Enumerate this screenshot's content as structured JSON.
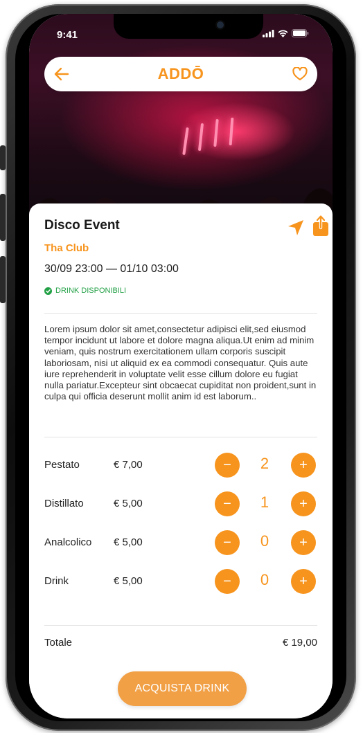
{
  "status_bar": {
    "time": "9:41"
  },
  "navbar": {
    "logo": "ADDŌ",
    "back_icon": "arrow-left-icon",
    "favorite_icon": "heart-icon"
  },
  "event": {
    "title": "Disco Event",
    "venue": "Tha Club",
    "dates": "30/09 23:00 — 01/10 03:00",
    "availability": "DRINK DISPONIBILI",
    "description": "Lorem ipsum dolor sit amet,consectetur adipisci elit,sed eiusmod tempor incidunt ut labore et dolore magna aliqua.Ut enim ad minim veniam, quis nostrum exercitationem ullam corporis suscipit laboriosam, nisi ut aliquid ex ea commodi consequatur. Quis aute iure reprehenderit in voluptate velit esse cillum dolore eu fugiat nulla pariatur.Excepteur sint obcaecat cupiditat non proident,sunt in culpa qui officia deserunt mollit anim id est laborum.."
  },
  "drinks": [
    {
      "name": "Pestato",
      "price": "€ 7,00",
      "qty": "2"
    },
    {
      "name": "Distillato",
      "price": "€ 5,00",
      "qty": "1"
    },
    {
      "name": "Analcolico",
      "price": "€ 5,00",
      "qty": "0"
    },
    {
      "name": "Drink",
      "price": "€ 5,00",
      "qty": "0"
    }
  ],
  "stepper": {
    "minus": "−",
    "plus": "+"
  },
  "total": {
    "label": "Totale",
    "value": "€ 19,00"
  },
  "buy_button": "ACQUISTA DRINK",
  "colors": {
    "accent": "#f7941d",
    "success": "#22a045",
    "button": "#f1a046"
  }
}
